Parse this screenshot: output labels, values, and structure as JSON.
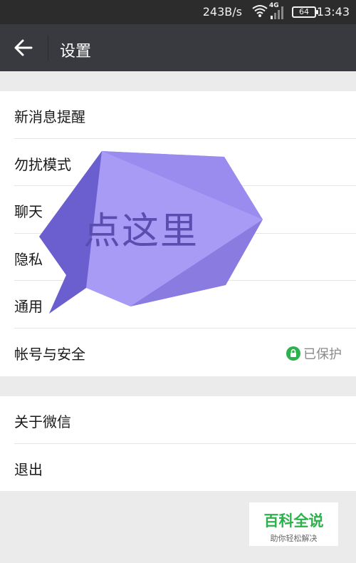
{
  "status_bar": {
    "net_speed": "243B/s",
    "network_type": "4G",
    "battery": "64",
    "time": "13:43"
  },
  "header": {
    "title": "设置",
    "back_icon": "arrow-left-icon"
  },
  "settings_group_1": [
    {
      "label": "新消息提醒"
    },
    {
      "label": "勿扰模式"
    },
    {
      "label": "聊天"
    },
    {
      "label": "隐私"
    },
    {
      "label": "通用"
    },
    {
      "label": "帐号与安全",
      "status": "已保护",
      "status_icon": "lock-icon",
      "status_color": "#2bb24c"
    }
  ],
  "settings_group_2": [
    {
      "label": "关于微信"
    },
    {
      "label": "退出"
    }
  ],
  "overlay": {
    "text": "点这里",
    "color": "#a89bf5"
  },
  "watermark": {
    "title": "百科全说",
    "subtitle": "助你轻松解决"
  }
}
